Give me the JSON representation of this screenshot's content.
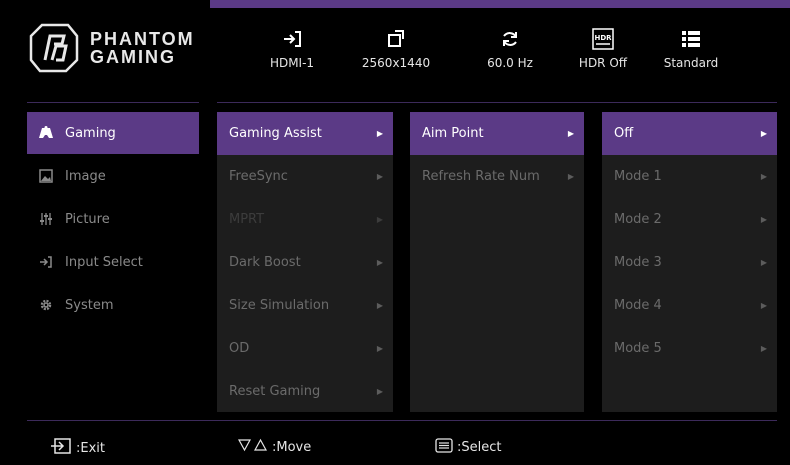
{
  "brand": {
    "line1": "PHANTOM",
    "line2": "GAMING"
  },
  "status": [
    {
      "icon": "input-arrow-icon",
      "value": "HDMI-1"
    },
    {
      "icon": "resolution-icon",
      "value": "2560x1440"
    },
    {
      "icon": "refresh-icon",
      "value": "60.0 Hz"
    },
    {
      "icon": "hdr-icon",
      "value": "HDR Off",
      "badge": "HDR"
    },
    {
      "icon": "list-icon",
      "value": "Standard"
    }
  ],
  "sidebar": [
    {
      "label": "Gaming",
      "icon": "gamepad-icon",
      "active": true
    },
    {
      "label": "Image",
      "icon": "image-icon"
    },
    {
      "label": "Picture",
      "icon": "sliders-icon"
    },
    {
      "label": "Input Select",
      "icon": "input-arrow-icon"
    },
    {
      "label": "System",
      "icon": "gear-icon"
    }
  ],
  "col1": [
    {
      "label": "Gaming Assist"
    },
    {
      "label": "FreeSync"
    },
    {
      "label": "MPRT"
    },
    {
      "label": "Dark Boost"
    },
    {
      "label": "Size Simulation"
    },
    {
      "label": "OD"
    },
    {
      "label": "Reset Gaming"
    }
  ],
  "col2": [
    {
      "label": "Aim Point"
    },
    {
      "label": "Refresh Rate Num"
    }
  ],
  "col3": [
    {
      "label": "Off"
    },
    {
      "label": "Mode 1"
    },
    {
      "label": "Mode 2"
    },
    {
      "label": "Mode 3"
    },
    {
      "label": "Mode 4"
    },
    {
      "label": "Mode 5"
    }
  ],
  "footer": {
    "exit": ":Exit",
    "move": ":Move",
    "select": ":Select"
  },
  "colors": {
    "accent": "#5b3a86",
    "panel": "#1d1d1d",
    "background": "#000000"
  }
}
